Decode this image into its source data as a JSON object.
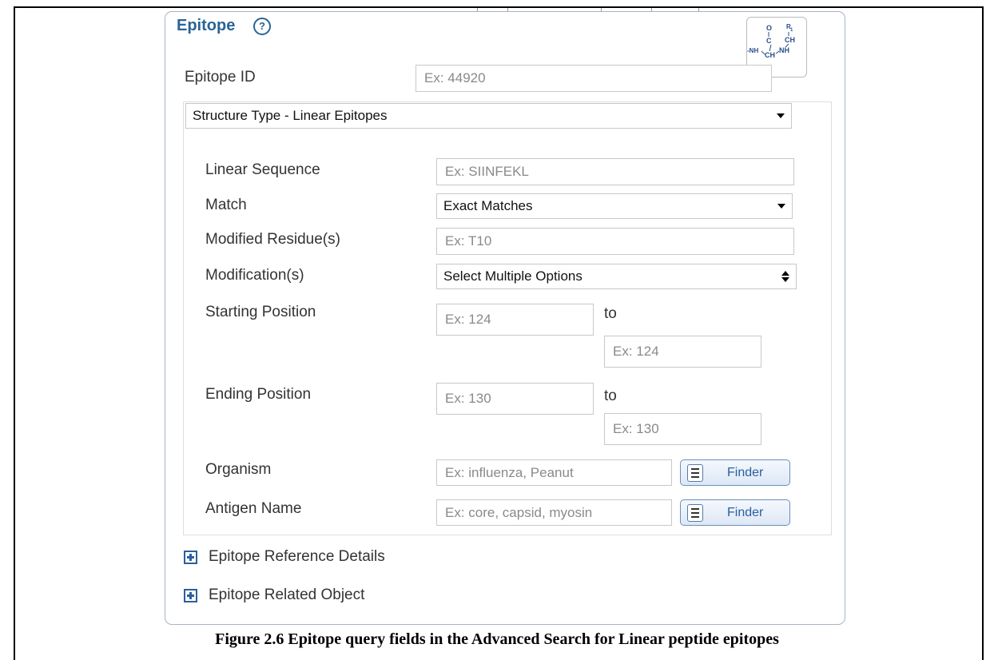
{
  "panel": {
    "title": "Epitope",
    "help_icon": "?",
    "chem_icon": "peptide-structure-icon"
  },
  "epitope_id": {
    "label": "Epitope ID",
    "placeholder": "Ex: 44920"
  },
  "structure_type": {
    "selected": "Structure Type - Linear Epitopes"
  },
  "linear_sequence": {
    "label": "Linear Sequence",
    "placeholder": "Ex: SIINFEKL"
  },
  "match": {
    "label": "Match",
    "selected": "Exact Matches"
  },
  "modified_residues": {
    "label": "Modified Residue(s)",
    "placeholder": "Ex: T10"
  },
  "modifications": {
    "label": "Modification(s)",
    "selected": "Select Multiple Options"
  },
  "starting_position": {
    "label": "Starting Position",
    "from_placeholder": "Ex: 124",
    "to_label": "to",
    "to_placeholder": "Ex: 124"
  },
  "ending_position": {
    "label": "Ending Position",
    "from_placeholder": "Ex: 130",
    "to_label": "to",
    "to_placeholder": "Ex: 130"
  },
  "organism": {
    "label": "Organism",
    "placeholder": "Ex: influenza, Peanut",
    "finder_label": "Finder"
  },
  "antigen_name": {
    "label": "Antigen Name",
    "placeholder": "Ex: core, capsid, myosin",
    "finder_label": "Finder"
  },
  "expanders": {
    "reference_details": "Epitope Reference Details",
    "related_object": "Epitope Related Object"
  },
  "caption": "Figure 2.6  Epitope query fields in the Advanced Search for Linear peptide epitopes"
}
